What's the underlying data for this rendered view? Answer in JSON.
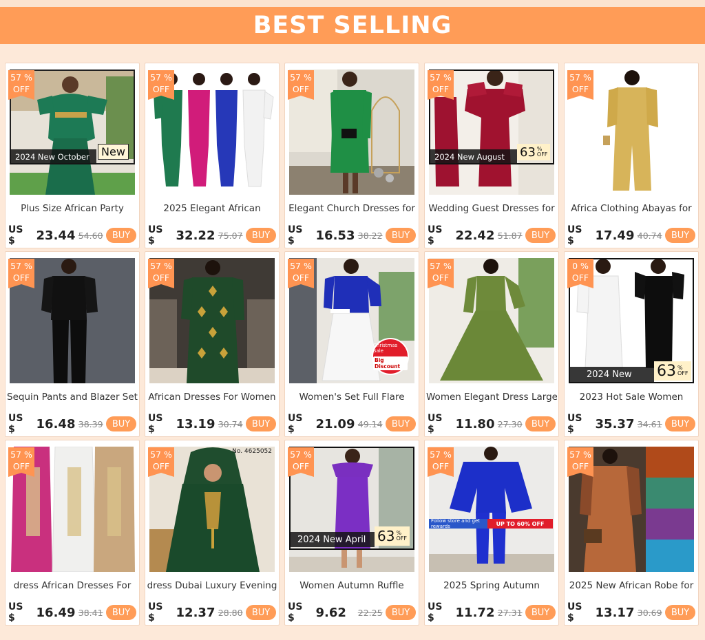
{
  "banner": {
    "title": "BEST SELLING"
  },
  "labels": {
    "currency": "US $",
    "buy": "BUY",
    "pct": "%",
    "off": "OFF"
  },
  "colors": {
    "accent": "#ff9c57",
    "background": "#fde9d9",
    "badge": "#ff9452"
  },
  "products": [
    {
      "title": "Plus Size African Party",
      "price": "23.44",
      "original": "54.60",
      "discount": "57",
      "overlay": {
        "bar": "2024 New October",
        "tag": "New"
      }
    },
    {
      "title": "2025 Elegant African",
      "price": "32.22",
      "original": "75.07",
      "discount": "57"
    },
    {
      "title": "Elegant Church Dresses for",
      "price": "16.53",
      "original": "38.22",
      "discount": "57"
    },
    {
      "title": "Wedding Guest Dresses for",
      "price": "22.42",
      "original": "51.87",
      "discount": "57",
      "overlay": {
        "bar": "2024 New August",
        "num": "63",
        "pct": "%",
        "off": "OFF"
      }
    },
    {
      "title": "Africa Clothing Abayas for",
      "price": "17.49",
      "original": "40.74",
      "discount": "57"
    },
    {
      "title": "Sequin Pants and Blazer Set",
      "price": "16.48",
      "original": "38.39",
      "discount": "57"
    },
    {
      "title": "African Dresses For Women",
      "price": "13.19",
      "original": "30.74",
      "discount": "57"
    },
    {
      "title": "Women's Set Full Flare",
      "price": "21.09",
      "original": "49.14",
      "discount": "57",
      "overlay": {
        "sticker1": "Christmas Sale",
        "sticker2": "Big Discount"
      }
    },
    {
      "title": "Women Elegant Dress Large",
      "price": "11.80",
      "original": "27.30",
      "discount": "57"
    },
    {
      "title": "2023 Hot Sale Women",
      "price": "35.37",
      "original": "34.61",
      "discount": "0",
      "overlay": {
        "bar": "2024 New",
        "num": "63",
        "pct": "%",
        "off": "OFF"
      }
    },
    {
      "title": "dress African Dresses For",
      "price": "16.49",
      "original": "38.41",
      "discount": "57"
    },
    {
      "title": "dress Dubai Luxury Evening",
      "price": "12.37",
      "original": "28.80",
      "discount": "57",
      "overlay": {
        "sku": "No. 4625052"
      }
    },
    {
      "title": "Women Autumn Ruffle",
      "price": "9.62",
      "original": "22.25",
      "discount": "57",
      "overlay": {
        "bar": "2024 New April",
        "num": "63",
        "pct": "%",
        "off": "OFF"
      }
    },
    {
      "title": "2025 Spring Autumn",
      "price": "11.72",
      "original": "27.31",
      "discount": "57",
      "overlay": {
        "sale_left": "Follow store and get rewards",
        "sale_right": "UP TO 60% OFF"
      }
    },
    {
      "title": "2025 New African Robe for",
      "price": "13.17",
      "original": "30.69",
      "discount": "57"
    }
  ]
}
